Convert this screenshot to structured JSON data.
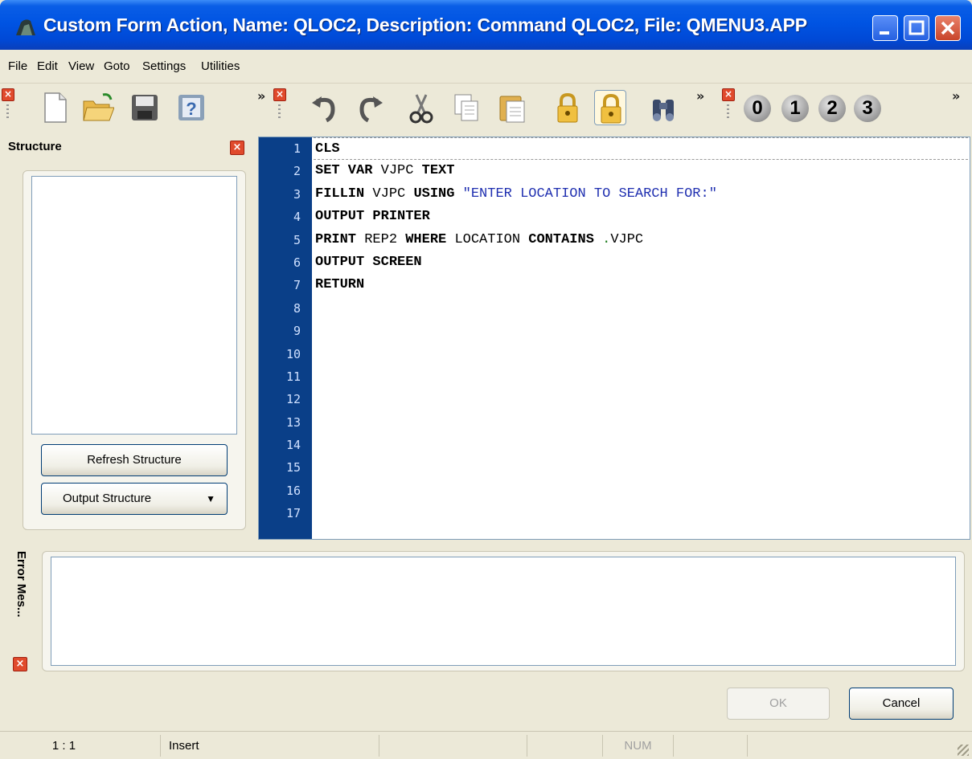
{
  "window": {
    "title": "Custom Form Action, Name: QLOC2, Description: Command QLOC2, File: QMENU3.APP"
  },
  "menu": [
    "File",
    "Edit",
    "View",
    "Goto",
    "Settings",
    "Utilities"
  ],
  "toolbar": {
    "more_glyph": "»",
    "close_glyph": "×",
    "numbers": [
      "0",
      "1",
      "2",
      "3"
    ]
  },
  "structure": {
    "title": "Structure",
    "refresh_label": "Refresh Structure",
    "output_label": "Output Structure",
    "dropdown_glyph": "▼"
  },
  "editor": {
    "line_numbers": [
      "1",
      "2",
      "3",
      "4",
      "5",
      "6",
      "7",
      "8",
      "9",
      "10",
      "11",
      "12",
      "13",
      "14",
      "15",
      "16",
      "17"
    ],
    "lines": [
      [
        {
          "t": "CLS",
          "c": "kw"
        }
      ],
      [
        {
          "t": "SET VAR",
          "c": "kw"
        },
        {
          "t": " VJPC ",
          "c": ""
        },
        {
          "t": "TEXT",
          "c": "kw"
        }
      ],
      [
        {
          "t": "FILLIN",
          "c": "kw"
        },
        {
          "t": " VJPC ",
          "c": ""
        },
        {
          "t": "USING",
          "c": "kw"
        },
        {
          "t": " \"ENTER LOCATION TO SEARCH FOR:\"",
          "c": "str"
        }
      ],
      [
        {
          "t": "OUTPUT PRINTER",
          "c": "kw"
        }
      ],
      [
        {
          "t": "PRINT",
          "c": "kw"
        },
        {
          "t": " REP2 ",
          "c": ""
        },
        {
          "t": "WHERE",
          "c": "kw"
        },
        {
          "t": " LOCATION ",
          "c": ""
        },
        {
          "t": "CONTAINS",
          "c": "kw"
        },
        {
          "t": " ",
          "c": ""
        },
        {
          "t": ".",
          "c": "dot"
        },
        {
          "t": "VJPC",
          "c": ""
        }
      ],
      [
        {
          "t": "OUTPUT SCREEN",
          "c": "kw"
        }
      ],
      [
        {
          "t": "RETURN",
          "c": "kw"
        }
      ]
    ]
  },
  "errors": {
    "title": "Error Mes..."
  },
  "buttons": {
    "ok": "OK",
    "cancel": "Cancel"
  },
  "status": {
    "position": "1 : 1",
    "mode": "Insert",
    "num": "NUM"
  },
  "colors": {
    "titlebar": "#0054e3",
    "gutter": "#0a3f88",
    "string": "#1f2fb0",
    "close_red": "#e04a2c"
  }
}
